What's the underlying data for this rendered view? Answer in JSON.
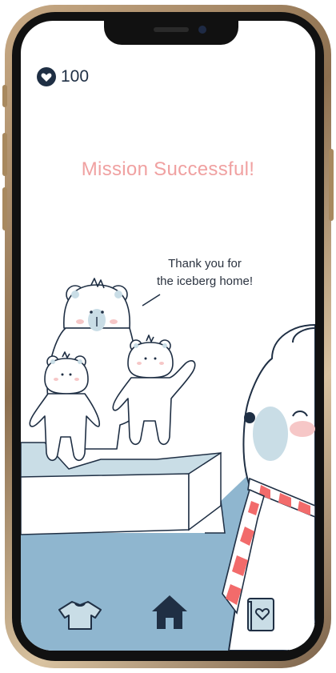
{
  "status": {
    "hearts_value": "100"
  },
  "main": {
    "title": "Mission Successful!",
    "speech_line1": "Thank you for",
    "speech_line2": "the iceberg home!"
  },
  "nav": {
    "items": [
      {
        "icon": "shirt-icon"
      },
      {
        "icon": "home-icon"
      },
      {
        "icon": "heart-book-icon"
      }
    ]
  },
  "colors": {
    "accent_title": "#f0a1a1",
    "navy": "#1f2f44",
    "water": "#8fb6cf",
    "ice_blue": "#c9dde6",
    "tie_red": "#f26b6b"
  }
}
